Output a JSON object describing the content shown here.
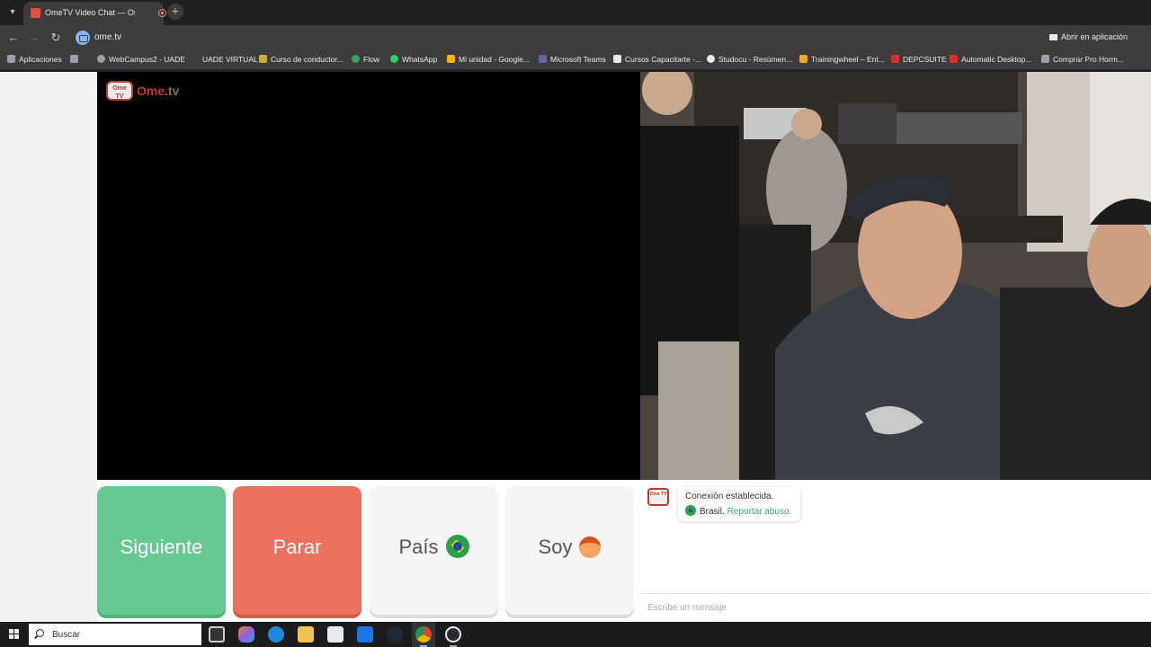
{
  "browser": {
    "tab_title": "OmeTV Video Chat — Ome",
    "tab_close": "×",
    "new_tab": "+",
    "url": "ome.tv",
    "open_in_app": "Abrir en aplicación",
    "back": "←",
    "forward": "→",
    "reload": "↻"
  },
  "bookmarks": [
    {
      "label": "Aplicaciones",
      "color": "#9aa0a6"
    },
    {
      "label": "WebCampus2 - UADE",
      "color": "#9aa0a6"
    },
    {
      "label": "UADE VIRTUAL",
      "color": "#3c3c3c"
    },
    {
      "label": "Curso de conductor...",
      "color": "#c9b037"
    },
    {
      "label": "Flow",
      "color": "#34a853"
    },
    {
      "label": "WhatsApp",
      "color": "#25d366"
    },
    {
      "label": "Mi unidad - Google...",
      "color": "#f4b400"
    },
    {
      "label": "Microsoft Teams",
      "color": "#6264a7"
    },
    {
      "label": "Cursos Capacitarte -...",
      "color": "#e8eaed"
    },
    {
      "label": "Studocu - Resúmen...",
      "color": "#e8eaed"
    },
    {
      "label": "Trainingwheel – Ent...",
      "color": "#f5a623"
    },
    {
      "label": "DEPCSUITE",
      "color": "#d93025"
    },
    {
      "label": "Automatic Desktop...",
      "color": "#d93025"
    },
    {
      "label": "Comprar Pro Horm...",
      "color": "#9aa0a6"
    }
  ],
  "logo": {
    "ome": "Ome",
    "tv": ".tv",
    "badge": "Ome TV"
  },
  "buttons": {
    "next": "Siguiente",
    "stop": "Parar",
    "country": "País",
    "gender": "Soy"
  },
  "chat": {
    "connected": "Conexión establecida.",
    "country": "Brasil.",
    "report": "Reportar abuso.",
    "placeholder": "Escribe un mensaje"
  },
  "taskbar": {
    "search_placeholder": "Buscar"
  },
  "colors": {
    "next": "#66c991",
    "stop": "#ec7060",
    "brand": "#c0392b"
  }
}
